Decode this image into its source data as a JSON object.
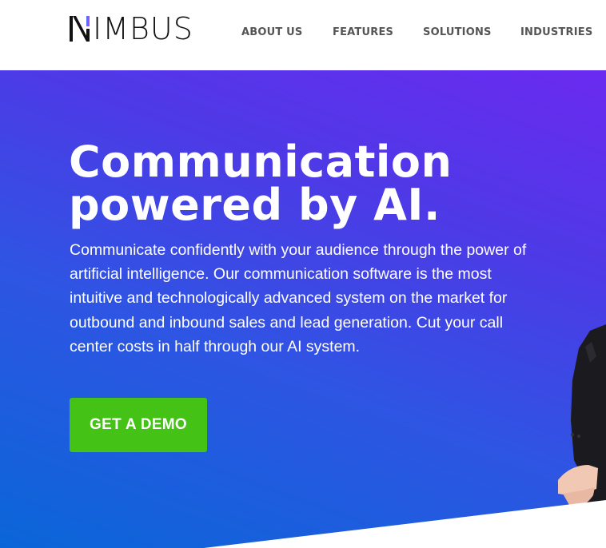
{
  "brand": {
    "logo_text": "NIMBUS",
    "logo_colors": {
      "mark_start": "#3a7bff",
      "mark_end": "#c23cff",
      "text": "#111111"
    }
  },
  "nav": {
    "items": [
      {
        "label": "ABOUT US"
      },
      {
        "label": "FEATURES"
      },
      {
        "label": "SOLUTIONS"
      },
      {
        "label": "INDUSTRIES"
      }
    ]
  },
  "hero": {
    "title_line1": "Communication",
    "title_line2": "powered by AI.",
    "description": "Communicate confidently with your audience through the power of artificial intelligence. Our communication software is the most intuitive and technologically advanced system on the market for outbound and inbound sales and lead generation. Cut your call center costs in half through our AI system.",
    "cta_label": "GET A DEMO",
    "colors": {
      "gradient_top_right": "#6b2af0",
      "gradient_bottom_left": "#0a66d8",
      "cta_background": "#44c215",
      "text": "#ffffff"
    }
  }
}
